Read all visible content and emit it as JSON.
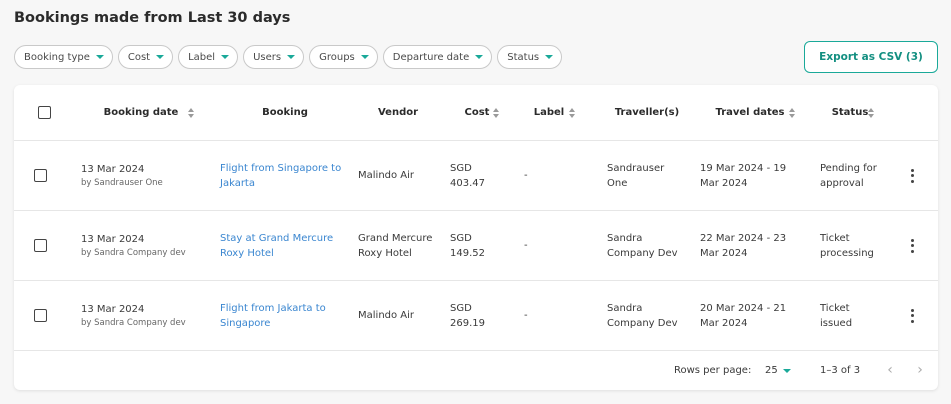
{
  "page": {
    "title": "Bookings made from Last 30 days"
  },
  "filters": [
    "Booking type",
    "Cost",
    "Label",
    "Users",
    "Groups",
    "Departure date",
    "Status"
  ],
  "export": {
    "label": "Export as CSV (3)"
  },
  "table": {
    "headers": {
      "booking_date": "Booking date",
      "booking": "Booking",
      "vendor": "Vendor",
      "cost": "Cost",
      "label": "Label",
      "travellers": "Traveller(s)",
      "travel_dates": "Travel dates",
      "status": "Status"
    },
    "rows": [
      {
        "date": "13 Mar 2024",
        "by": "by Sandrauser One",
        "booking": "Flight from Singapore to Jakarta",
        "vendor": "Malindo Air",
        "cost": "SGD 403.47",
        "label": "-",
        "travellers": "Sandrauser One",
        "travel_dates": "19 Mar 2024 - 19 Mar 2024",
        "status": "Pending for approval"
      },
      {
        "date": "13 Mar 2024",
        "by": "by Sandra Company dev",
        "booking": "Stay at Grand Mercure Roxy Hotel",
        "vendor": "Grand Mercure Roxy Hotel",
        "cost": "SGD 149.52",
        "label": "-",
        "travellers": "Sandra Company Dev",
        "travel_dates": "22 Mar 2024 - 23 Mar 2024",
        "status": "Ticket processing"
      },
      {
        "date": "13 Mar 2024",
        "by": "by Sandra Company dev",
        "booking": "Flight from Jakarta to Singapore",
        "vendor": "Malindo Air",
        "cost": "SGD 269.19",
        "label": "-",
        "travellers": "Sandra Company Dev",
        "travel_dates": "20 Mar 2024 - 21 Mar 2024",
        "status": "Ticket issued"
      }
    ]
  },
  "pagination": {
    "rows_per_page_label": "Rows per page:",
    "rows_per_page": "25",
    "range": "1–3 of 3"
  },
  "colors": {
    "accent": "#1aa999",
    "link": "#3a86d0"
  },
  "icons": [
    "chevron-down-icon",
    "sort-icon",
    "more-vert-icon",
    "chevron-left-icon",
    "chevron-right-icon"
  ]
}
